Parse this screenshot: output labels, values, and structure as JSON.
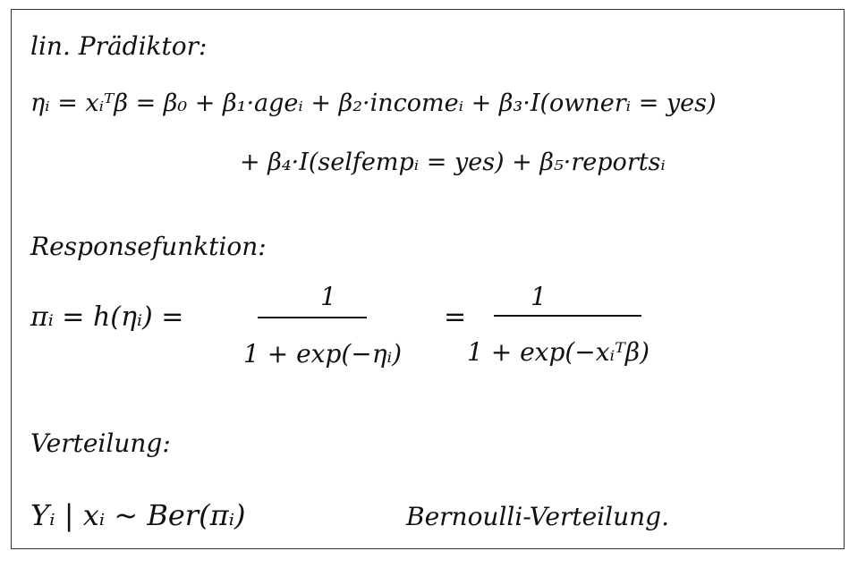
{
  "sections": {
    "predictor": {
      "heading": "lin. Prädiktor:",
      "line1": "ηᵢ = xᵢᵀβ = β₀ + β₁·ageᵢ + β₂·incomeᵢ + β₃·I(ownerᵢ = yes)",
      "line2": "+ β₄·I(selfempᵢ = yes) + β₅·reportsᵢ"
    },
    "response": {
      "heading": "Responsefunktion:",
      "lhs": "πᵢ = h(ηᵢ) =",
      "frac1_num": "1",
      "frac1_den": "1 + exp(−ηᵢ)",
      "equals2": "=",
      "frac2_num": "1",
      "frac2_den": "1 + exp(−xᵢᵀβ)"
    },
    "distribution": {
      "heading": "Verteilung:",
      "formula": "Yᵢ | xᵢ ~ Ber(πᵢ)",
      "note": "Bernoulli-Verteilung."
    }
  }
}
